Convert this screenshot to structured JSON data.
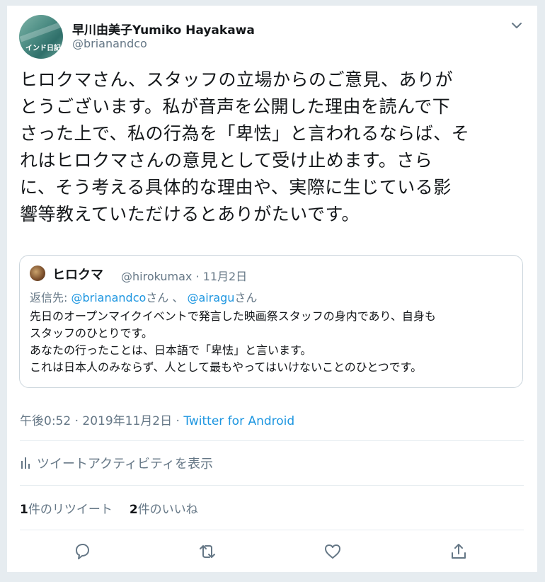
{
  "author": {
    "display_name": "早川由美子Yumiko Hayakawa",
    "handle": "@brianandco",
    "avatar_text": "インド日記"
  },
  "tweet": {
    "text": "ヒロクマさん、スタッフの立場からのご意見、ありが\nとうございます。私が音声を公開した理由を読んで下\nさった上で、私の行為を「卑怯」と言われるならば、そ\nれはヒロクマさんの意見として受け止めます。さら\nに、そう考える具体的な理由や、実際に生じている影\n響等教えていただけるとありがたいです。"
  },
  "quote": {
    "name": "ヒロクマ",
    "meta": "@hirokumax · 11月2日",
    "reply_prefix": "返信先: ",
    "mention1": "@brianandco",
    "mention1_suffix": "さん 、 ",
    "mention2": "@airagu",
    "mention2_suffix": "さん",
    "text": "先日のオープンマイクイベントで発言した映画祭スタッフの身内であり、自身も\nスタッフのひとりです。\nあなたの行ったことは、日本語で「卑怯」と言います。\nこれは日本人のみならず、人として最もやってはいけないことのひとつです。"
  },
  "meta": {
    "timestamp": "午後0:52 · 2019年11月2日 · ",
    "source": "Twitter for Android"
  },
  "activity": {
    "label": "ツイートアクティビティを表示"
  },
  "stats": {
    "retweet_count": "1",
    "retweet_label": "件のリツイート",
    "like_count": "2",
    "like_label": "件のいいね"
  },
  "actions": [
    "reply-icon",
    "retweet-icon",
    "like-icon",
    "share-icon"
  ],
  "colors": {
    "link": "#1b95e0",
    "secondary_text": "#657786",
    "primary_text": "#14171a",
    "border": "#ccd6dd"
  }
}
